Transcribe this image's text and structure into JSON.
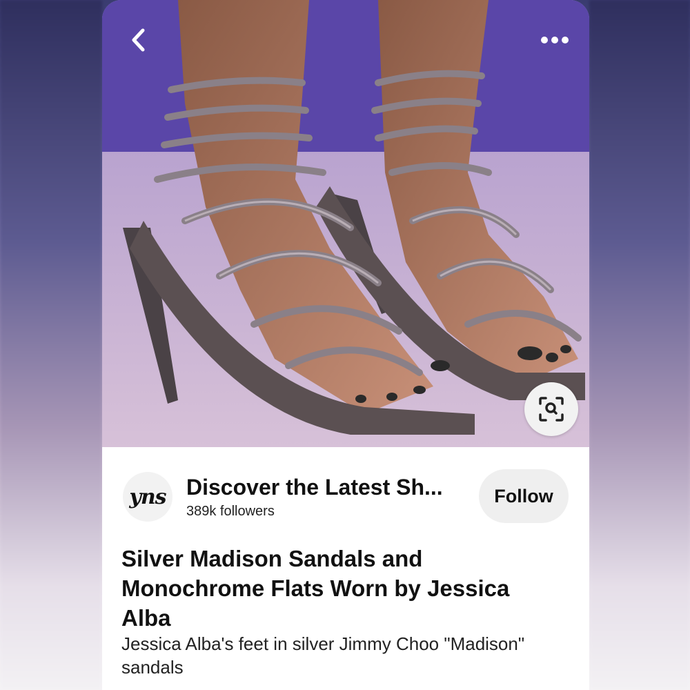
{
  "photo": {
    "alt_subject": "strappy sandals",
    "back_icon": "chevron-left-icon",
    "more_icon": "more-horizontal-icon",
    "lens_icon": "visual-search-icon"
  },
  "profile": {
    "avatar_text": "yns",
    "board_title": "Discover the Latest Sh...",
    "followers": "389k followers",
    "follow_label": "Follow"
  },
  "pin": {
    "title": "Silver Madison Sandals and Monochrome Flats Worn by Jessica Alba",
    "description": "Jessica Alba's feet in silver Jimmy Choo \"Madison\" sandals"
  },
  "colors": {
    "card_bg": "#ffffff",
    "follow_bg": "#efefef",
    "text_primary": "#111111"
  }
}
